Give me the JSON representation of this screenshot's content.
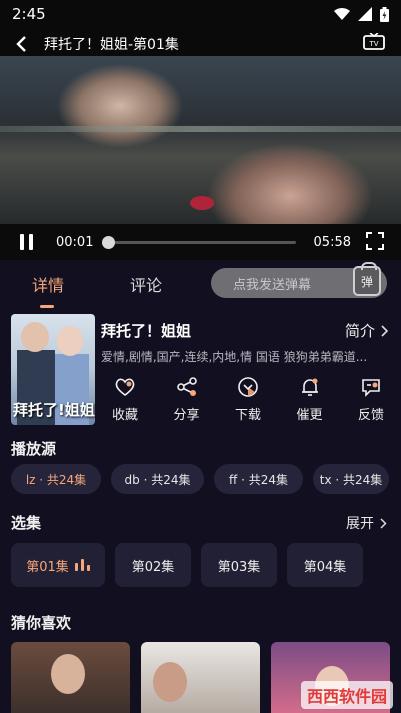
{
  "status": {
    "time": "2:45"
  },
  "header": {
    "title": "拜托了！姐姐-第01集"
  },
  "player": {
    "current_time": "00:01",
    "duration": "05:58",
    "progress": 0.003
  },
  "tabs": [
    {
      "label": "详情"
    },
    {
      "label": "评论"
    }
  ],
  "danmaku": {
    "placeholder": "点我发送弹幕",
    "icon_label": "弹"
  },
  "show": {
    "title": "拜托了！姐姐",
    "poster_text": "拜托了!姐姐",
    "intro_label": "简介",
    "tags": "爱情,剧情,国产,连续,内地,情 国语 狼狗弟弟霸道..."
  },
  "actions": [
    {
      "label": "收藏",
      "icon": "heart-icon"
    },
    {
      "label": "分享",
      "icon": "share-icon"
    },
    {
      "label": "下载",
      "icon": "download-icon"
    },
    {
      "label": "催更",
      "icon": "bell-icon"
    },
    {
      "label": "反馈",
      "icon": "feedback-icon"
    }
  ],
  "sources": {
    "title": "播放源",
    "items": [
      {
        "label": "lz · 共24集"
      },
      {
        "label": "db · 共24集"
      },
      {
        "label": "ff · 共24集"
      },
      {
        "label": "tx · 共24集"
      }
    ]
  },
  "episodes": {
    "title": "选集",
    "more_label": "展开",
    "items": [
      {
        "label": "第01集"
      },
      {
        "label": "第02集"
      },
      {
        "label": "第03集"
      },
      {
        "label": "第04集"
      }
    ]
  },
  "recommend": {
    "title": "猜你喜欢",
    "watermark": "西西软件园"
  },
  "colors": {
    "accent": "#f5a67a",
    "background": "#121020",
    "chip": "#26243a"
  }
}
